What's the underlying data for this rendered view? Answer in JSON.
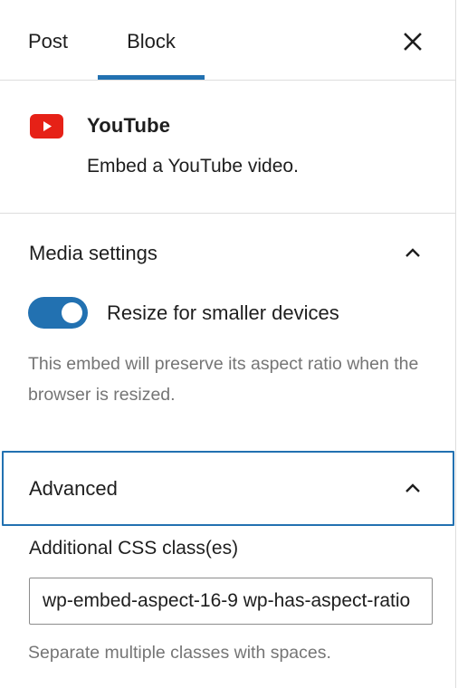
{
  "tabs": {
    "post": "Post",
    "block": "Block"
  },
  "block": {
    "title": "YouTube",
    "description": "Embed a YouTube video."
  },
  "media_settings": {
    "title": "Media settings",
    "toggle_label": "Resize for smaller devices",
    "toggle_on": true,
    "help": "This embed will preserve its aspect ratio when the browser is resized."
  },
  "advanced": {
    "title": "Advanced",
    "css_label": "Additional CSS class(es)",
    "css_value": "wp-embed-aspect-16-9 wp-has-aspect-ratio",
    "css_help": "Separate multiple classes with spaces."
  },
  "colors": {
    "accent": "#2271b1",
    "youtube_red": "#e62117",
    "help_text": "#757575"
  }
}
